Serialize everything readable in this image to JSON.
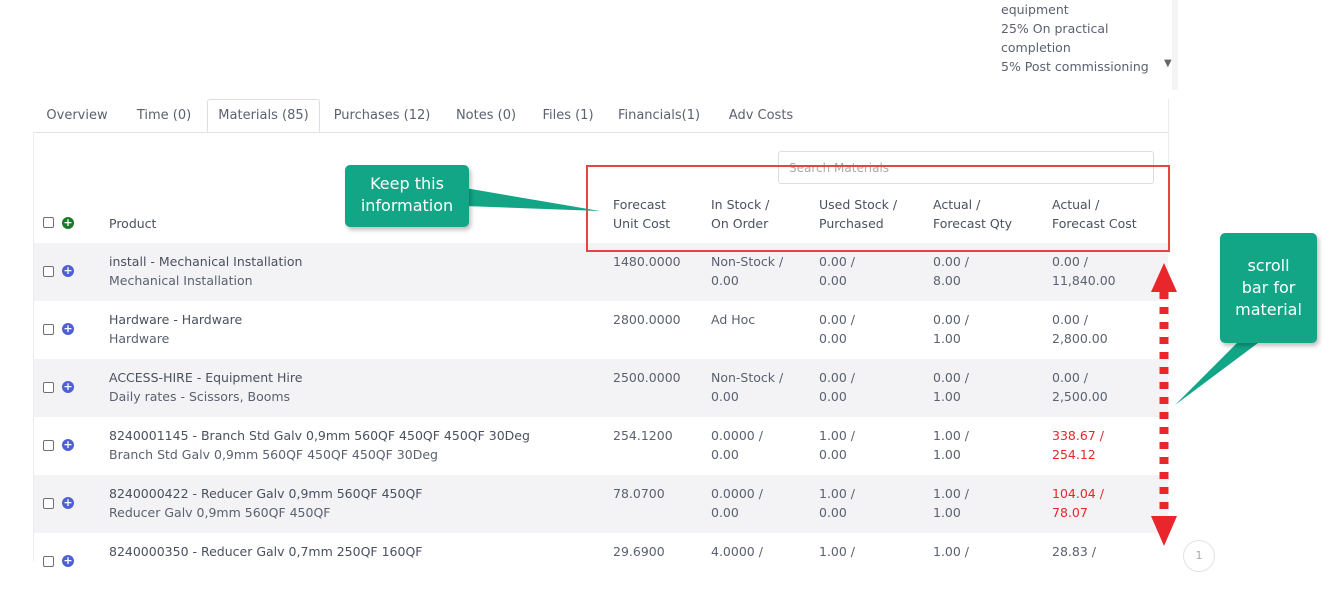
{
  "top_dropdown": {
    "lines": [
      "equipment",
      "25% On practical",
      "completion",
      "5% Post commissioning"
    ]
  },
  "tabs": [
    {
      "label": "Overview"
    },
    {
      "label": "Time (0)"
    },
    {
      "label": "Materials (85)",
      "active": true
    },
    {
      "label": "Purchases (12)"
    },
    {
      "label": "Notes (0)"
    },
    {
      "label": "Files (1)"
    },
    {
      "label": "Financials(1)"
    },
    {
      "label": "Adv Costs"
    }
  ],
  "search": {
    "placeholder": "Search Materials"
  },
  "header": {
    "product": "Product",
    "forecast_unit_cost": [
      "Forecast",
      "Unit Cost"
    ],
    "in_stock": [
      "In Stock /",
      "On Order"
    ],
    "used_stock": [
      "Used Stock /",
      "Purchased"
    ],
    "actual_qty": [
      "Actual /",
      "Forecast Qty"
    ],
    "actual_cost": [
      "Actual /",
      "Forecast Cost"
    ]
  },
  "rows": [
    {
      "title": "install - Mechanical Installation",
      "subtitle": "Mechanical Installation",
      "unit_cost": "1480.0000",
      "stock_1": "Non-Stock /",
      "stock_2": "0.00",
      "used_1": "0.00 /",
      "used_2": "0.00",
      "qty_1": "0.00 /",
      "qty_2": "8.00",
      "cost_1": "0.00 /",
      "cost_2": "11,840.00",
      "cost_red": false
    },
    {
      "title": "Hardware - Hardware",
      "subtitle": "Hardware",
      "unit_cost": "2800.0000",
      "stock_1": "Ad Hoc",
      "stock_2": "",
      "used_1": "0.00 /",
      "used_2": "0.00",
      "qty_1": "0.00 /",
      "qty_2": "1.00",
      "cost_1": "0.00 /",
      "cost_2": "2,800.00",
      "cost_red": false
    },
    {
      "title": "ACCESS-HIRE - Equipment Hire",
      "subtitle": "Daily rates - Scissors, Booms",
      "unit_cost": "2500.0000",
      "stock_1": "Non-Stock /",
      "stock_2": "0.00",
      "used_1": "0.00 /",
      "used_2": "0.00",
      "qty_1": "0.00 /",
      "qty_2": "1.00",
      "cost_1": "0.00 /",
      "cost_2": "2,500.00",
      "cost_red": false
    },
    {
      "title": "8240001145 - Branch Std Galv 0,9mm 560QF 450QF 450QF 30Deg",
      "subtitle": "Branch Std Galv 0,9mm 560QF 450QF 450QF 30Deg",
      "unit_cost": "254.1200",
      "stock_1": "0.0000 /",
      "stock_2": "0.00",
      "used_1": "1.00 /",
      "used_2": "0.00",
      "qty_1": "1.00 /",
      "qty_2": "1.00",
      "cost_1": "338.67 /",
      "cost_2": "254.12",
      "cost_red": true
    },
    {
      "title": "8240000422 - Reducer Galv 0,9mm 560QF 450QF",
      "subtitle": "Reducer Galv 0,9mm 560QF 450QF",
      "unit_cost": "78.0700",
      "stock_1": "0.0000 /",
      "stock_2": "0.00",
      "used_1": "1.00 /",
      "used_2": "0.00",
      "qty_1": "1.00 /",
      "qty_2": "1.00",
      "cost_1": "104.04 /",
      "cost_2": "78.07",
      "cost_red": true
    },
    {
      "title": "8240000350 - Reducer Galv 0,7mm 250QF 160QF",
      "subtitle": "",
      "unit_cost": "29.6900",
      "stock_1": "4.0000 /",
      "stock_2": "",
      "used_1": "1.00 /",
      "used_2": "",
      "qty_1": "1.00 /",
      "qty_2": "",
      "cost_1": "28.83 /",
      "cost_2": "",
      "cost_red": false
    }
  ],
  "annotations": {
    "keep_info": [
      "Keep this",
      "information"
    ],
    "scroll_note": [
      "scroll",
      "bar for",
      "material"
    ],
    "callout_color": "#12a687",
    "highlight_color": "#e64545",
    "arrow_color": "#e8262c"
  },
  "corner_widget": "1"
}
